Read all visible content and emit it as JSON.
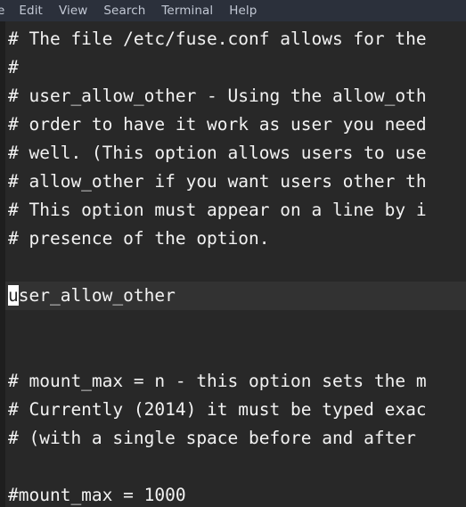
{
  "window": {
    "background": "#282828",
    "gutter_color": "#1e1e1e",
    "text_color": "#f2f2f2",
    "current_line_color": "#323232",
    "cursor_color": "#ffffff"
  },
  "menubar": {
    "background": "#2b303b",
    "text_color": "#c2c8d4",
    "items": [
      {
        "label": "e",
        "name": "menu-file",
        "clipped": true
      },
      {
        "label": "Edit",
        "name": "menu-edit",
        "clipped": false
      },
      {
        "label": "View",
        "name": "menu-view",
        "clipped": false
      },
      {
        "label": "Search",
        "name": "menu-search",
        "clipped": false
      },
      {
        "label": "Terminal",
        "name": "menu-terminal",
        "clipped": false
      },
      {
        "label": "Help",
        "name": "menu-help",
        "clipped": false
      }
    ]
  },
  "editor": {
    "cursor": {
      "line_index": 9,
      "column": 0,
      "char": "u"
    },
    "lines": [
      {
        "text": "# The file /etc/fuse.conf allows for the",
        "current": false
      },
      {
        "text": "#",
        "current": false
      },
      {
        "text": "# user_allow_other - Using the allow_oth",
        "current": false
      },
      {
        "text": "# order to have it work as user you need",
        "current": false
      },
      {
        "text": "# well. (This option allows users to use",
        "current": false
      },
      {
        "text": "# allow_other if you want users other th",
        "current": false
      },
      {
        "text": "# This option must appear on a line by i",
        "current": false
      },
      {
        "text": "# presence of the option.",
        "current": false
      },
      {
        "text": "",
        "current": false
      },
      {
        "text": "user_allow_other",
        "current": true
      },
      {
        "text": "",
        "current": false
      },
      {
        "text": "",
        "current": false
      },
      {
        "text": "# mount_max = n - this option sets the m",
        "current": false
      },
      {
        "text": "# Currently (2014) it must be typed exac",
        "current": false
      },
      {
        "text": "# (with a single space before and after",
        "current": false
      },
      {
        "text": "",
        "current": false
      },
      {
        "text": "#mount_max = 1000",
        "current": false
      }
    ]
  }
}
